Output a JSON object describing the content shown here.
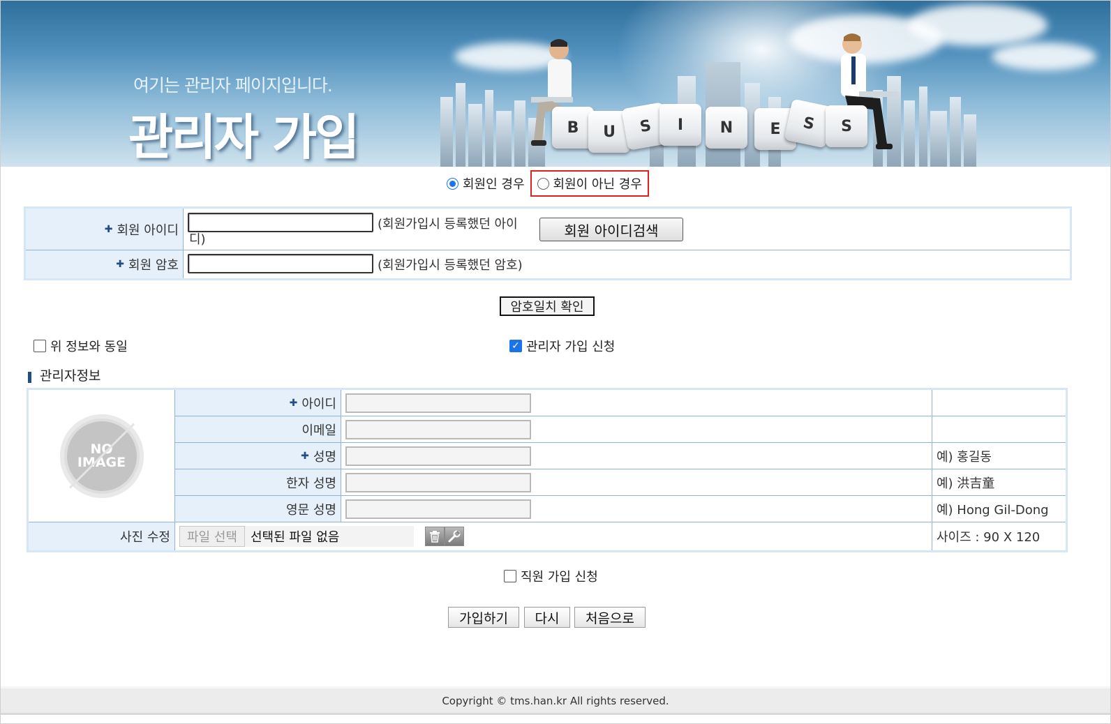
{
  "banner": {
    "subtitle": "여기는 관리자 페이지입니다.",
    "title": "관리자 가입",
    "key_letters": [
      "B",
      "U",
      "S",
      "I",
      "N",
      "E",
      "S",
      "S"
    ]
  },
  "member_type": {
    "options": [
      {
        "label": "회원인 경우",
        "checked": true
      },
      {
        "label": "회원이 아닌 경우",
        "checked": false
      }
    ]
  },
  "member_login": {
    "id_label": "회원 아이디",
    "id_value": "",
    "id_hint": "(회원가입시 등록했던 아이디)",
    "id_hint_line1": "(회원가입시 등록했던 아이",
    "id_hint_line2": "디)",
    "search_button": "회원 아이디검색",
    "pw_label": "회원 암호",
    "pw_value": "",
    "pw_hint": "(회원가입시 등록했던 암호)",
    "confirm_button": "암호일치 확인"
  },
  "options": {
    "same_as_above": {
      "label": "위 정보와 동일",
      "checked": false
    },
    "apply_admin": {
      "label": "관리자 가입 신청",
      "checked": true
    },
    "apply_staff": {
      "label": "직원 가입 신청",
      "checked": false
    }
  },
  "admin_info": {
    "section_title": "관리자정보",
    "photo_placeholder": "NO\nIMAGE",
    "rows": [
      {
        "label": "아이디",
        "required": true,
        "value": "",
        "example": ""
      },
      {
        "label": "이메일",
        "required": false,
        "value": "",
        "example": ""
      },
      {
        "label": "성명",
        "required": true,
        "value": "",
        "example": "예) 홍길동"
      },
      {
        "label": "한자 성명",
        "required": false,
        "value": "",
        "example": "예) 洪吉童"
      },
      {
        "label": "영문 성명",
        "required": false,
        "value": "",
        "example": "예) Hong Gil-Dong"
      }
    ],
    "photo_edit_label": "사진 수정",
    "file_button": "파일 선택",
    "file_status": "선택된 파일 없음",
    "size_note": "사이즈 : 90 X 120"
  },
  "actions": {
    "join": "가입하기",
    "reset": "다시",
    "home": "처음으로"
  },
  "footer": {
    "copyright": "Copyright © tms.han.kr All rights reserved."
  },
  "colors": {
    "label_bg": "#e6f0fb",
    "border": "#8fb3d9",
    "accent": "#1f4d8a",
    "highlight": "#e02020"
  }
}
